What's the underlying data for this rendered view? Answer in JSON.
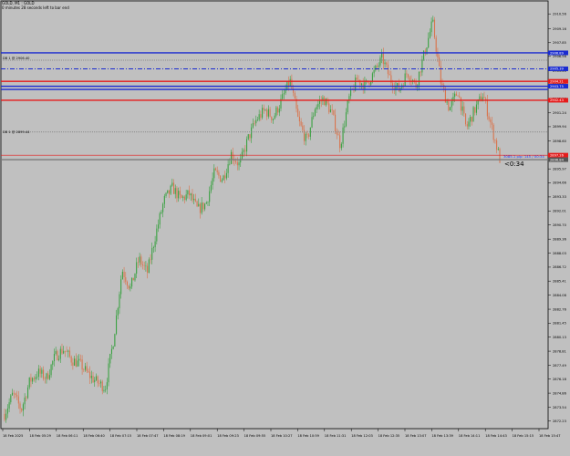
{
  "header": {
    "symbol": "GOLD, M1 : GOLD",
    "timer": "0 minutes 28 seconds left to bar end"
  },
  "countdown": "<0:34",
  "info_text": "3085.1 pip: 145 / 00:34",
  "level_labels": [
    {
      "text": "DB 1 @ 2906.40",
      "price": 2906.4
    },
    {
      "text": "DB 1 @ 2899.44",
      "price": 2899.44
    }
  ],
  "price_tags": [
    {
      "text": "2906.89",
      "price": 2906.89,
      "color": "#1a2bd0"
    },
    {
      "text": "2905.39",
      "price": 2905.39,
      "color": "#1a2bd0"
    },
    {
      "text": "2904.21",
      "price": 2904.21,
      "color": "#e51b1b"
    },
    {
      "text": "2903.75",
      "price": 2903.75,
      "color": "#1a2bd0"
    },
    {
      "text": "2902.43",
      "price": 2902.43,
      "color": "#e51b1b"
    },
    {
      "text": "2897.26",
      "price": 2897.26,
      "color": "#e51b1b"
    },
    {
      "text": "2896.84",
      "price": 2896.84,
      "color": "#555555"
    }
  ],
  "colors": {
    "background": "#c0c0c0",
    "bull": "#3aa142",
    "bear": "#d9744d",
    "blue_level": "#1a2bd0",
    "red_level": "#e51b1b"
  },
  "chart_data": {
    "type": "candlestick",
    "ylim": [
      2871.52,
      2911.78
    ],
    "y_ticks": [
      "2910.56",
      "2909.16",
      "2907.85",
      "2906.56",
      "2905.20",
      "2903.89",
      "2902.56",
      "2901.24",
      "2899.94",
      "2898.60",
      "2897.28",
      "2895.97",
      "2894.66",
      "2893.33",
      "2892.01",
      "2890.70",
      "2889.36",
      "2888.03",
      "2886.72",
      "2885.41",
      "2884.08",
      "2882.76",
      "2881.45",
      "2880.13",
      "2878.81",
      "2877.49",
      "2876.18",
      "2874.86",
      "2873.54",
      "2872.23"
    ],
    "x_ticks": [
      "18 Feb 2025",
      "18 Feb 05:29",
      "18 Feb 06:11",
      "18 Feb 06:40",
      "18 Feb 07:15",
      "18 Feb 07:47",
      "18 Feb 08:19",
      "18 Feb 09:01",
      "18 Feb 09:23",
      "18 Feb 09:55",
      "18 Feb 10:27",
      "18 Feb 10:59",
      "18 Feb 11:31",
      "18 Feb 12:03",
      "18 Feb 12:35",
      "18 Feb 13:07",
      "18 Feb 13:39",
      "18 Feb 14:11",
      "18 Feb 14:43",
      "18 Feb 15:15",
      "18 Feb 15:47"
    ],
    "levels": [
      {
        "price": 2906.89,
        "color": "blue",
        "style": "solid"
      },
      {
        "price": 2906.2,
        "color": "gray",
        "style": "dotted"
      },
      {
        "price": 2905.39,
        "color": "blue",
        "style": "dashdot"
      },
      {
        "price": 2904.21,
        "color": "red",
        "style": "solid"
      },
      {
        "price": 2903.75,
        "color": "blue",
        "style": "solid"
      },
      {
        "price": 2903.45,
        "color": "blue",
        "style": "solid"
      },
      {
        "price": 2902.43,
        "color": "red",
        "style": "solid"
      },
      {
        "price": 2899.44,
        "color": "gray",
        "style": "dotted"
      },
      {
        "price": 2897.26,
        "color": "red",
        "style": "thin"
      },
      {
        "price": 2896.84,
        "color": "gray",
        "style": "solid"
      }
    ],
    "path": [
      {
        "price": 2872.9
      },
      {
        "price": 2874.8
      },
      {
        "price": 2873.3
      },
      {
        "price": 2876.0
      },
      {
        "price": 2876.8
      },
      {
        "price": 2876.3
      },
      {
        "price": 2878.3
      },
      {
        "price": 2879.0
      },
      {
        "price": 2878.0
      },
      {
        "price": 2877.6
      },
      {
        "price": 2876.6
      },
      {
        "price": 2875.9
      },
      {
        "price": 2875.4
      },
      {
        "price": 2880.0
      },
      {
        "price": 2886.5
      },
      {
        "price": 2884.7
      },
      {
        "price": 2887.5
      },
      {
        "price": 2886.2
      },
      {
        "price": 2889.8
      },
      {
        "price": 2893.0
      },
      {
        "price": 2894.2
      },
      {
        "price": 2893.1
      },
      {
        "price": 2893.6
      },
      {
        "price": 2892.1
      },
      {
        "price": 2892.7
      },
      {
        "price": 2895.6
      },
      {
        "price": 2895.0
      },
      {
        "price": 2897.4
      },
      {
        "price": 2896.3
      },
      {
        "price": 2898.8
      },
      {
        "price": 2900.6
      },
      {
        "price": 2901.5
      },
      {
        "price": 2900.8
      },
      {
        "price": 2902.4
      },
      {
        "price": 2904.3
      },
      {
        "price": 2900.5
      },
      {
        "price": 2898.5
      },
      {
        "price": 2901.8
      },
      {
        "price": 2902.6
      },
      {
        "price": 2901.2
      },
      {
        "price": 2898.2
      },
      {
        "price": 2902.5
      },
      {
        "price": 2904.4
      },
      {
        "price": 2903.8
      },
      {
        "price": 2905.0
      },
      {
        "price": 2906.4
      },
      {
        "price": 2904.3
      },
      {
        "price": 2903.4
      },
      {
        "price": 2905.1
      },
      {
        "price": 2903.8
      },
      {
        "price": 2906.8
      },
      {
        "price": 2909.8
      },
      {
        "price": 2904.0
      },
      {
        "price": 2901.6
      },
      {
        "price": 2903.3
      },
      {
        "price": 2899.8
      },
      {
        "price": 2901.5
      },
      {
        "price": 2903.0
      },
      {
        "price": 2900.0
      },
      {
        "price": 2896.9
      }
    ]
  }
}
